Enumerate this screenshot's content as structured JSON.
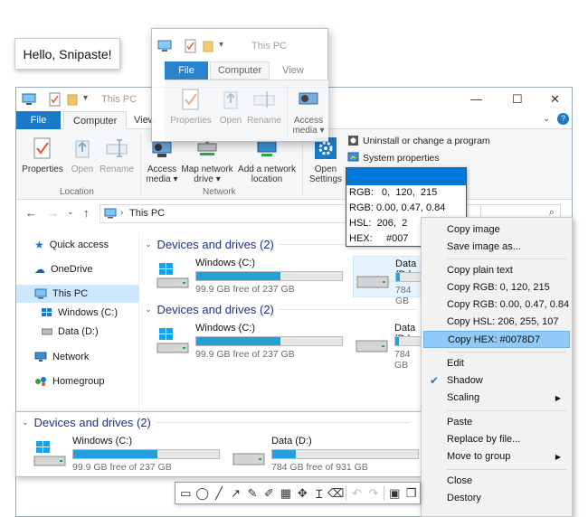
{
  "hello": {
    "text": "Hello, Snipaste!"
  },
  "window": {
    "title": "This PC",
    "tabs": {
      "file": "File",
      "computer": "Computer",
      "view": "View"
    },
    "ribbon": {
      "properties": "Properties",
      "open": "Open",
      "rename": "Rename",
      "location_group": "Location",
      "access_media_1": "Access",
      "access_media_2": "media ▾",
      "map_drive_1": "Map network",
      "map_drive_2": "drive ▾",
      "add_location_1": "Add a network",
      "add_location_2": "location",
      "network_group": "Network",
      "open_settings_1": "Open",
      "open_settings_2": "Settings",
      "uninstall": "Uninstall or change a program",
      "system_props": "System properties"
    },
    "address": {
      "path": "This PC"
    },
    "nav": {
      "quick_access": "Quick access",
      "onedrive": "OneDrive",
      "this_pc": "This PC",
      "windows_c": "Windows (C:)",
      "data_d": "Data (D:)",
      "network": "Network",
      "homegroup": "Homegroup"
    },
    "section_title": "Devices and drives (2)",
    "drives": [
      {
        "name": "Windows (C:)",
        "free": "99.9 GB free of 237 GB",
        "used_fraction": 0.58
      },
      {
        "name": "Data (D:)",
        "free": "784 GB free of 931 GB",
        "used_fraction": 0.16
      }
    ]
  },
  "overlay": {
    "title": "This PC",
    "file_tab": "File",
    "computer_tab": "Computer",
    "view_tab": "View",
    "properties": "Properties",
    "open": "Open",
    "rename": "Rename",
    "access_1": "Access",
    "access_2": "media ▾"
  },
  "picker": {
    "swatch_color": "#0078D7",
    "rgb": "RGB:   0,  120,  215",
    "rgb_f": "RGB: 0.00, 0.47, 0.84",
    "hsl": "HSL:  206,  2",
    "hex": "HEX:     #007"
  },
  "menu": {
    "copy_image": "Copy image",
    "save_image": "Save image as...",
    "copy_plain": "Copy plain text",
    "copy_rgb": "Copy RGB: 0, 120, 215",
    "copy_rgbf": "Copy RGB: 0.00, 0.47, 0.84",
    "copy_hsl": "Copy HSL: 206, 255, 107",
    "copy_hex": "Copy HEX: #0078D7",
    "edit": "Edit",
    "shadow": "Shadow",
    "scaling": "Scaling",
    "paste": "Paste",
    "replace": "Replace by file...",
    "move_group": "Move to group",
    "close": "Close",
    "destroy": "Destory"
  },
  "colors": {
    "accent": "#1979CA",
    "bar_fill": "#26A0DA",
    "highlight": "#91C9F7"
  }
}
